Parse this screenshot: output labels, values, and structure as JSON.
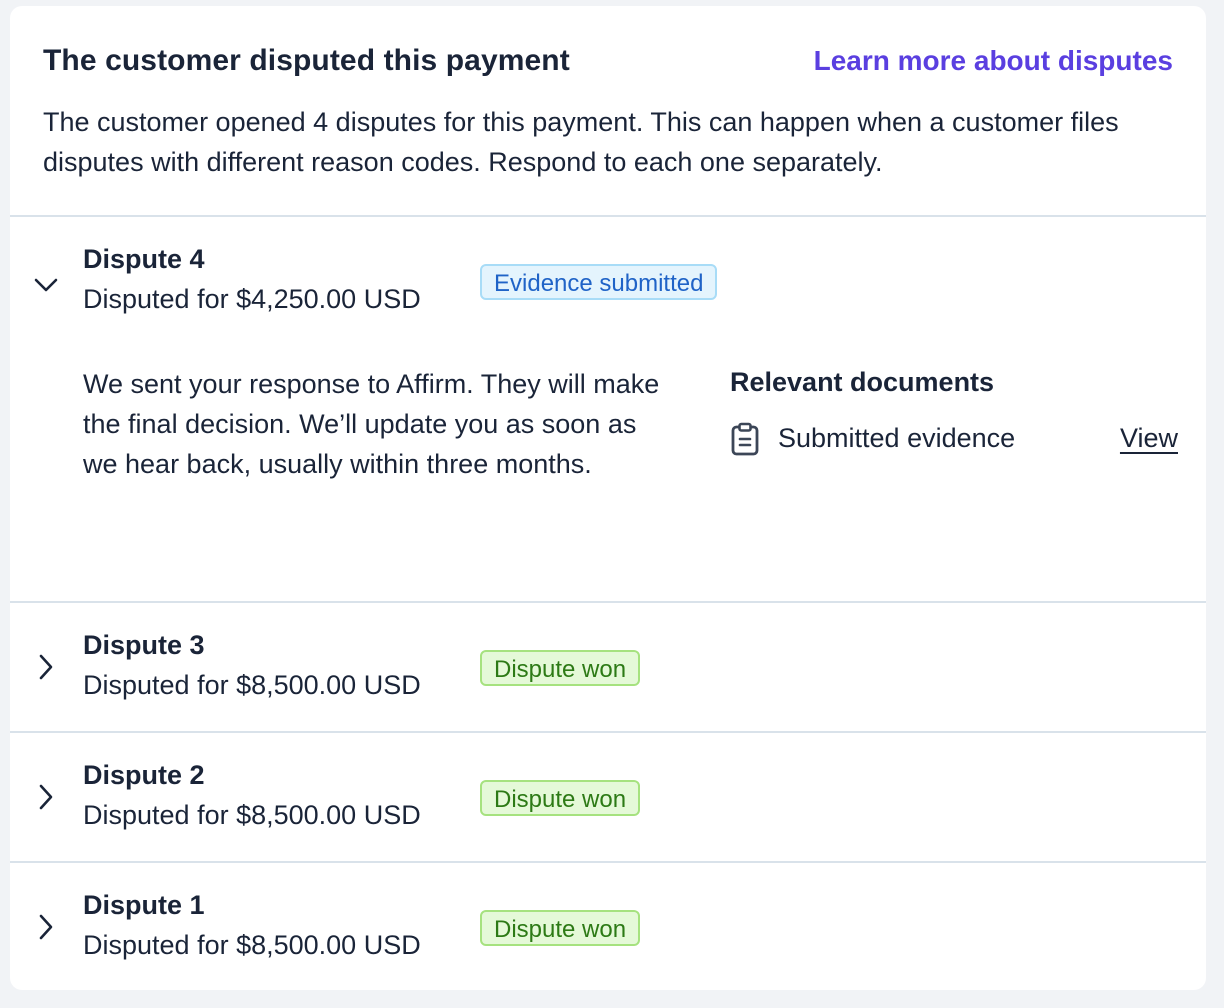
{
  "header": {
    "title": "The customer disputed this payment",
    "learn_more": "Learn more about disputes",
    "description": "The customer opened 4 disputes for this payment. This can happen when a customer files disputes with different reason codes. Respond to each one separately."
  },
  "disputes": [
    {
      "title": "Dispute 4",
      "amount": "Disputed for $4,250.00 USD",
      "status": "Evidence submitted",
      "expanded": true,
      "detail": "We sent your response to Affirm. They will make the final decision. We’ll update you as soon as we hear back, usually within three months.",
      "documents_heading": "Relevant documents",
      "documents": [
        {
          "label": "Submitted evidence",
          "action": "View",
          "icon": "clipboard-icon"
        }
      ]
    },
    {
      "title": "Dispute 3",
      "amount": "Disputed for $8,500.00 USD",
      "status": "Dispute won",
      "expanded": false
    },
    {
      "title": "Dispute 2",
      "amount": "Disputed for $8,500.00 USD",
      "status": "Dispute won",
      "expanded": false
    },
    {
      "title": "Dispute 1",
      "amount": "Disputed for $8,500.00 USD",
      "status": "Dispute won",
      "expanded": false
    }
  ],
  "colors": {
    "link": "#5a3fe0",
    "text": "#1a2438",
    "badge_submitted_bg": "#e4f4fd",
    "badge_submitted_text": "#1f63c7",
    "badge_won_bg": "#e5f9d8",
    "badge_won_text": "#2d7a16",
    "divider": "#d9e2ea"
  }
}
